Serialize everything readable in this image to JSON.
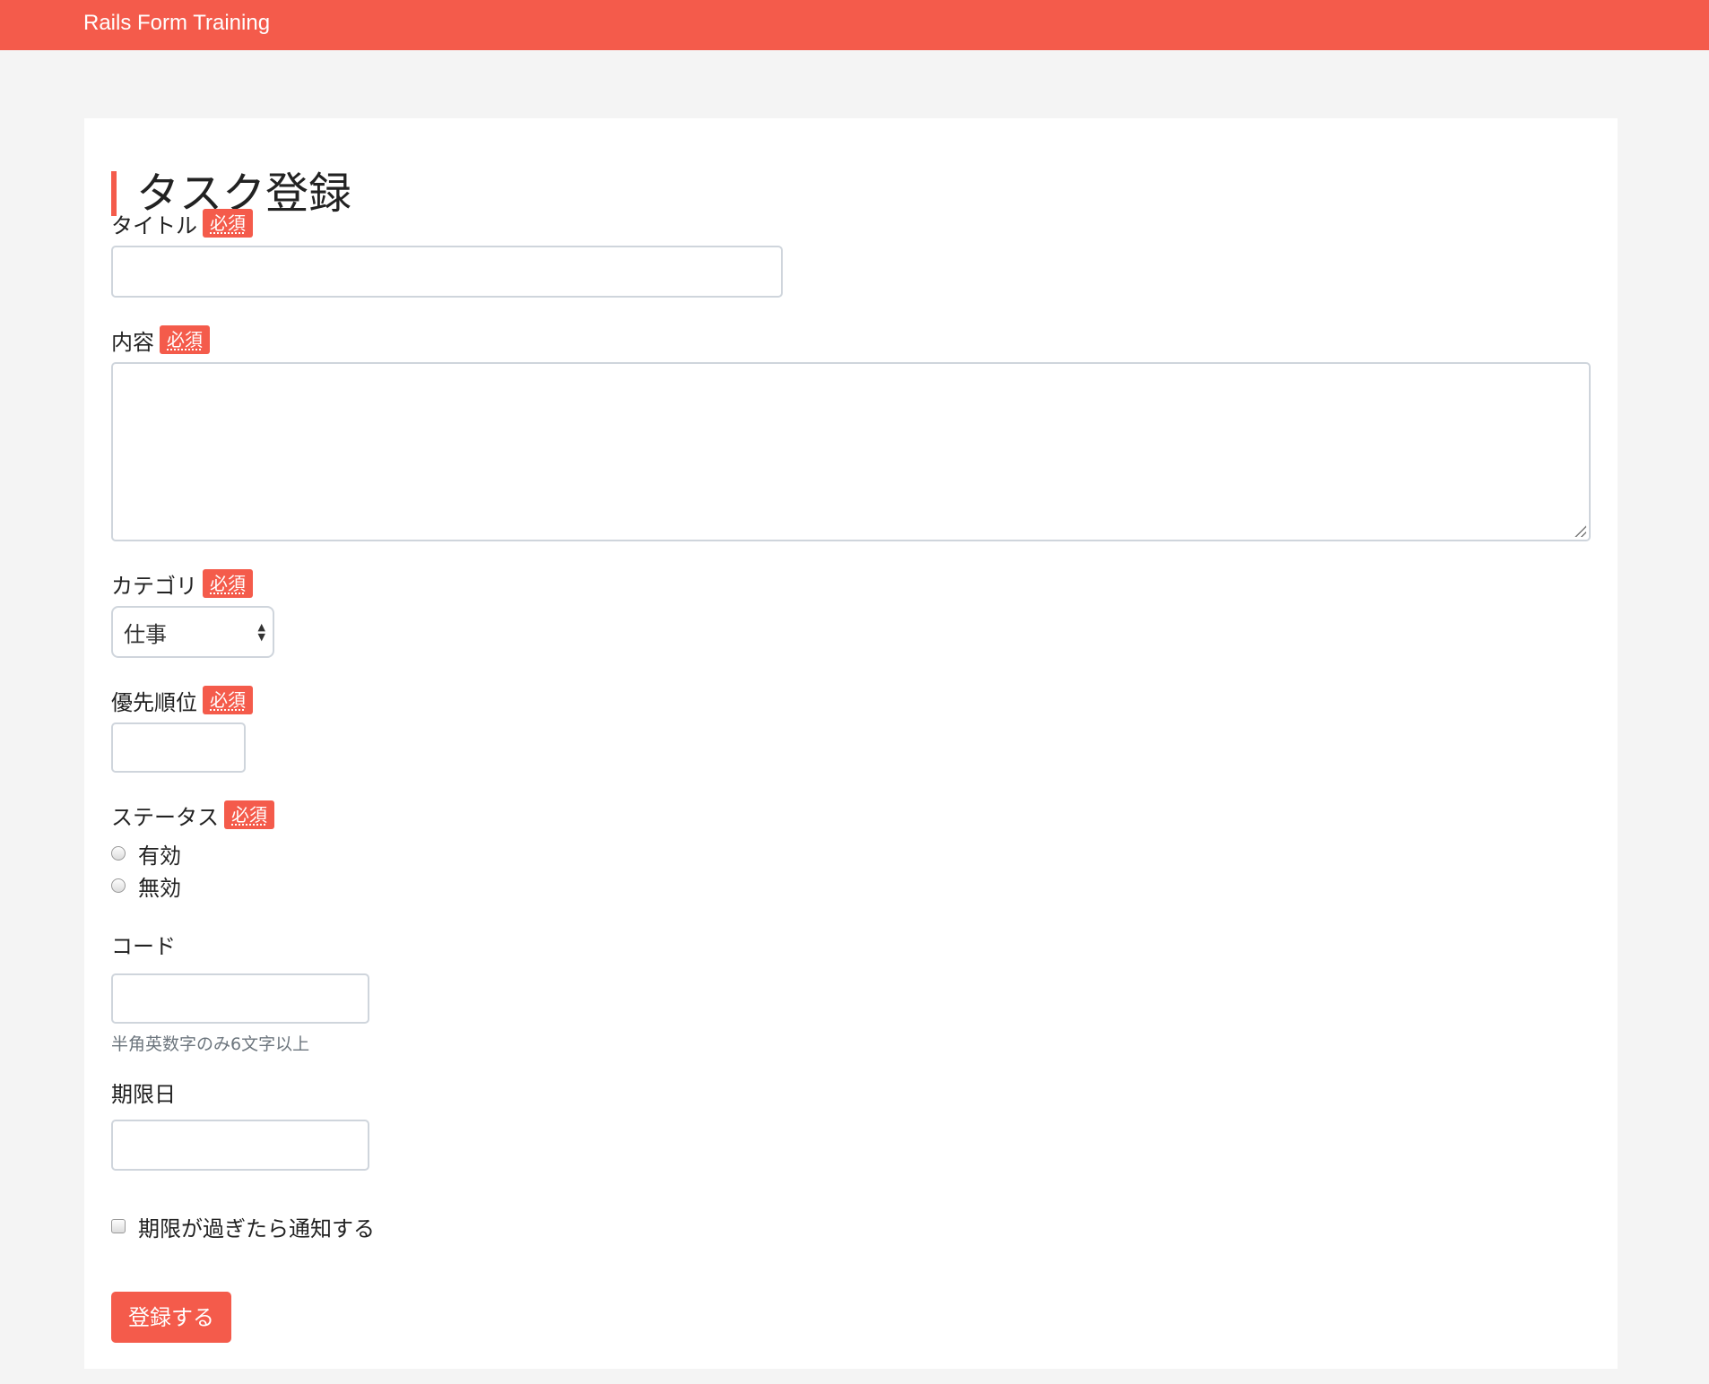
{
  "navbar": {
    "brand": "Rails Form Training"
  },
  "page": {
    "title": "タスク登録"
  },
  "required_badge": "必須",
  "form": {
    "title": {
      "label": "タイトル",
      "value": ""
    },
    "content": {
      "label": "内容",
      "value": ""
    },
    "category": {
      "label": "カテゴリ",
      "selected": "仕事"
    },
    "priority": {
      "label": "優先順位",
      "value": ""
    },
    "status": {
      "label": "ステータス",
      "options": [
        "有効",
        "無効"
      ]
    },
    "code": {
      "label": "コード",
      "value": "",
      "help": "半角英数字のみ6文字以上"
    },
    "due_date": {
      "label": "期限日",
      "value": ""
    },
    "notify": {
      "label": "期限が過ぎたら通知する"
    },
    "submit_label": "登録する"
  },
  "colors": {
    "brand": "#f45b4b",
    "background": "#f4f4f4",
    "card": "#ffffff",
    "border": "#cfd5dc",
    "help_text": "#6c757d"
  }
}
